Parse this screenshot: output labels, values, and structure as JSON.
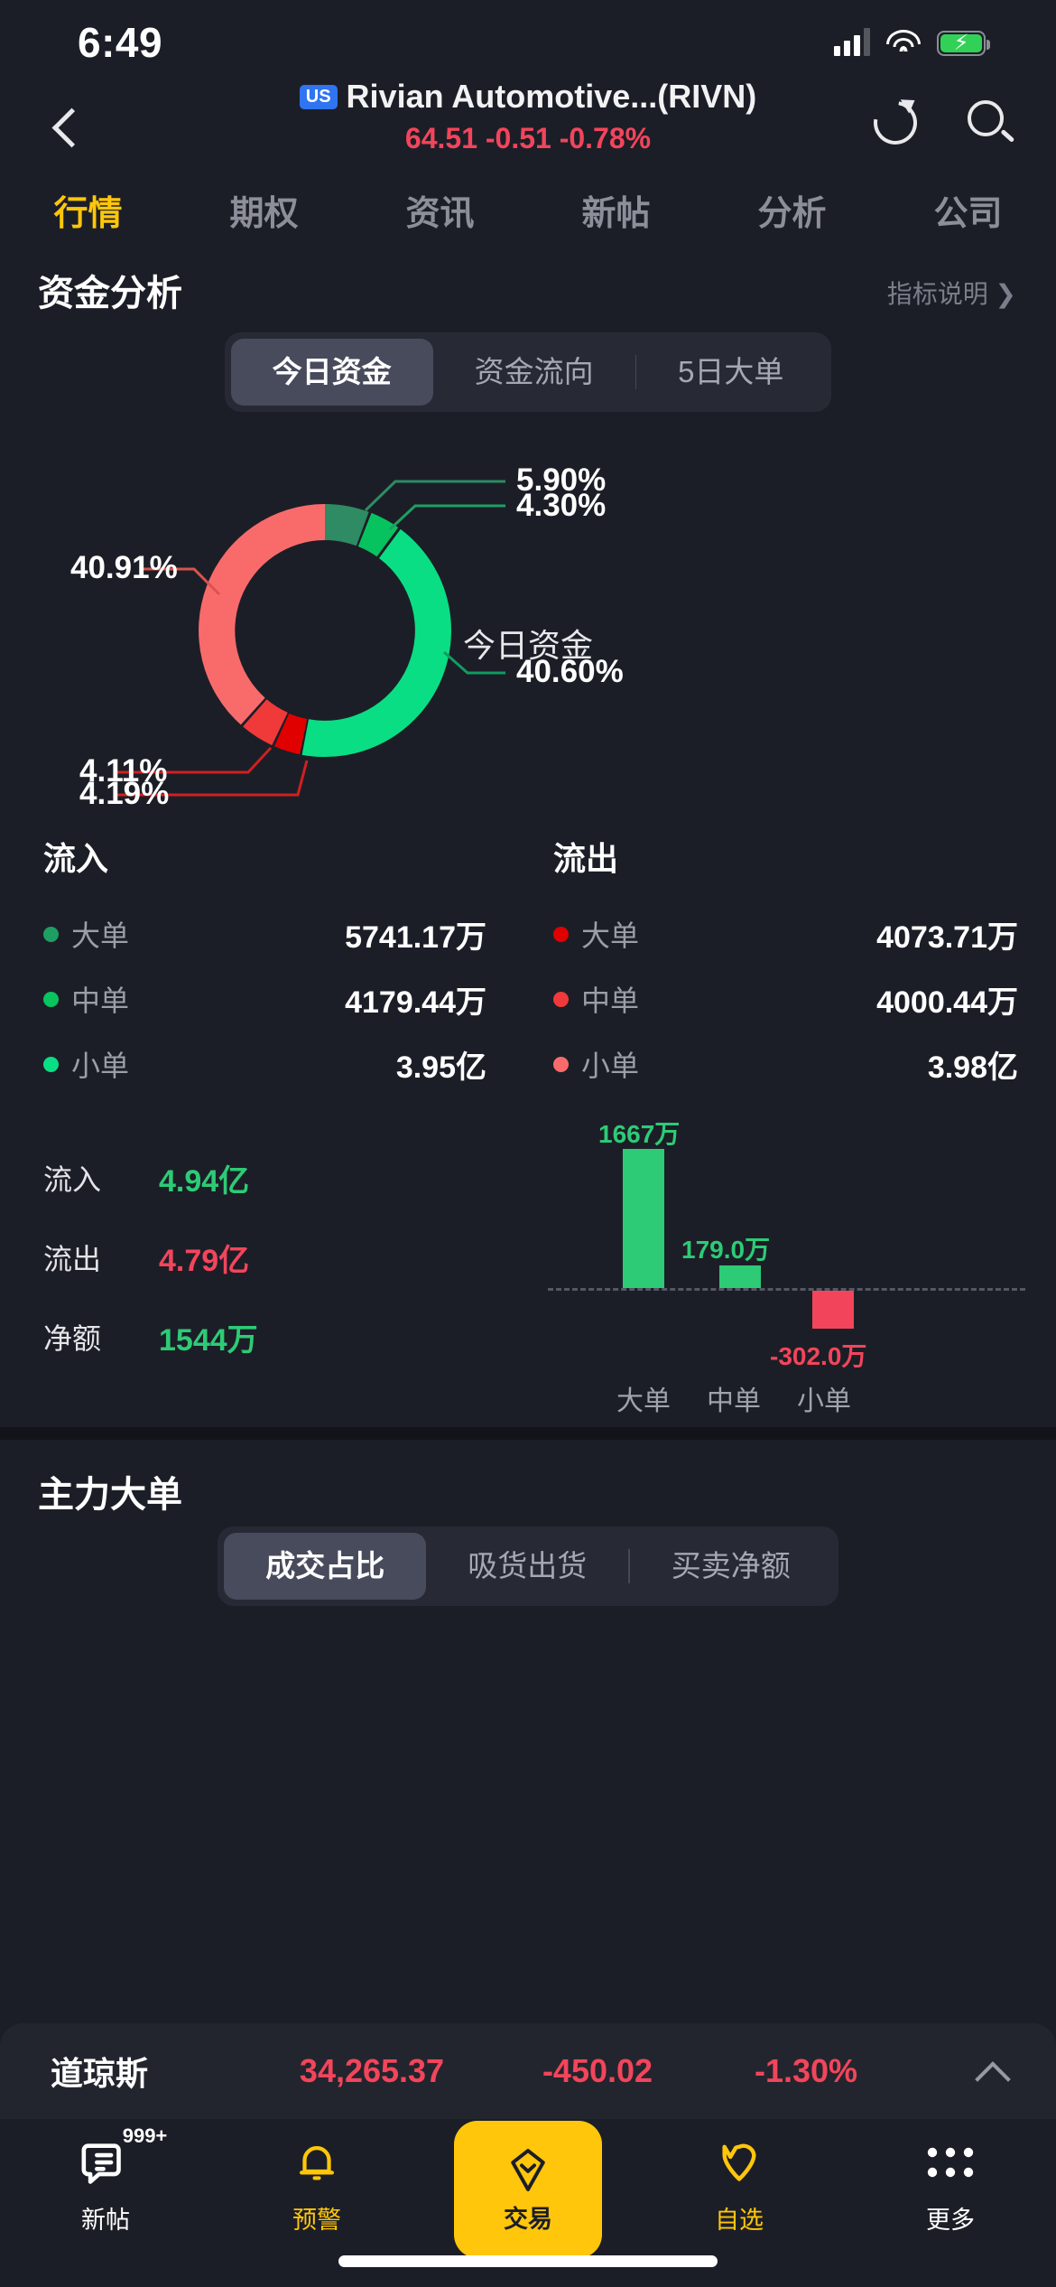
{
  "status_bar": {
    "time": "6:49",
    "signal_icon": "cellular-signal-icon",
    "wifi_icon": "wifi-icon",
    "battery_icon": "battery-charging-icon"
  },
  "header": {
    "back_icon": "back-chevron-icon",
    "market_badge": "US",
    "stock_name": "Rivian Automotive...(RIVN)",
    "quote": "64.51 -0.51 -0.78%",
    "quote_color": "#F2455B",
    "refresh_icon": "refresh-icon",
    "search_icon": "search-icon"
  },
  "section_tabs": {
    "active_index": 0,
    "items": [
      {
        "label": "行情"
      },
      {
        "label": "期权"
      },
      {
        "label": "资讯"
      },
      {
        "label": "新帖"
      },
      {
        "label": "分析"
      },
      {
        "label": "公司"
      }
    ]
  },
  "fund_analysis": {
    "title": "资金分析",
    "indicator_link": "指标说明 ❯",
    "segments": {
      "active_index": 0,
      "items": [
        {
          "label": "今日资金"
        },
        {
          "label": "资金流向"
        },
        {
          "label": "5日大单"
        }
      ]
    },
    "donut_center_label": "今日资金"
  },
  "chart_data": [
    {
      "type": "pie",
      "title": "今日资金",
      "labels": [
        "5.90%",
        "4.30%",
        "40.60%",
        "40.91%",
        "4.11%",
        "4.19%"
      ],
      "values": [
        5.9,
        4.3,
        40.6,
        40.91,
        4.11,
        4.19
      ],
      "colors": [
        "#2E8B63",
        "#07C35F",
        "#0ADE84",
        "#F96B6B",
        "#F03A3A",
        "#E00000"
      ],
      "legend": "none",
      "note": "donut, starts at 12 o'clock; greens clockwise (inflow), reds counter-clockwise (outflow)"
    },
    {
      "type": "bar",
      "categories": [
        "大单",
        "中单",
        "小单"
      ],
      "values": [
        1667,
        179.0,
        -302.0
      ],
      "value_labels": [
        "1667万",
        "179.0万",
        "-302.0万"
      ],
      "colors": [
        "#2DCB76",
        "#2DCB76",
        "#F2455B"
      ],
      "ylabel": "",
      "xlabel": "",
      "grid": false,
      "zero_line": true,
      "title": ""
    }
  ],
  "flows": {
    "inflow": {
      "header": "流入",
      "rows": [
        {
          "name": "大单",
          "value": "5741.17万",
          "dot": "#1E9E63"
        },
        {
          "name": "中单",
          "value": "4179.44万",
          "dot": "#09C45F"
        },
        {
          "name": "小单",
          "value": "3.95亿",
          "dot": "#0ADE84"
        }
      ]
    },
    "outflow": {
      "header": "流出",
      "rows": [
        {
          "name": "大单",
          "value": "4073.71万",
          "dot": "#E00000"
        },
        {
          "name": "中单",
          "value": "4000.44万",
          "dot": "#F03A3A"
        },
        {
          "name": "小单",
          "value": "3.98亿",
          "dot": "#F96B6B"
        }
      ]
    }
  },
  "summary": {
    "rows": [
      {
        "label": "流入",
        "value": "4.94亿",
        "color": "#2DCB76"
      },
      {
        "label": "流出",
        "value": "4.79亿",
        "color": "#F2455B"
      },
      {
        "label": "净额",
        "value": "1544万",
        "color": "#2DCB76"
      }
    ]
  },
  "main_orders": {
    "title": "主力大单",
    "segments": {
      "active_index": 0,
      "items": [
        {
          "label": "成交占比"
        },
        {
          "label": "吸货出货"
        },
        {
          "label": "买卖净额"
        }
      ]
    }
  },
  "index_ticker": {
    "name": "道琼斯",
    "price": "34,265.37",
    "change": "-450.02",
    "percent": "-1.30%",
    "color": "#F2455B",
    "caret_icon": "chevron-up-icon"
  },
  "tab_bar": {
    "active": "交易",
    "items": [
      {
        "label": "新帖",
        "icon": "feed-icon",
        "badge": "999+",
        "active": false
      },
      {
        "label": "预警",
        "icon": "bell-icon",
        "badge": "",
        "active": true
      },
      {
        "label": "交易",
        "icon": "trade-icon",
        "badge": "",
        "active": true
      },
      {
        "label": "自选",
        "icon": "heart-icon",
        "badge": "",
        "active": true
      },
      {
        "label": "更多",
        "icon": "grid-more-icon",
        "badge": "",
        "active": false
      }
    ],
    "accent": "#FFC60B"
  }
}
